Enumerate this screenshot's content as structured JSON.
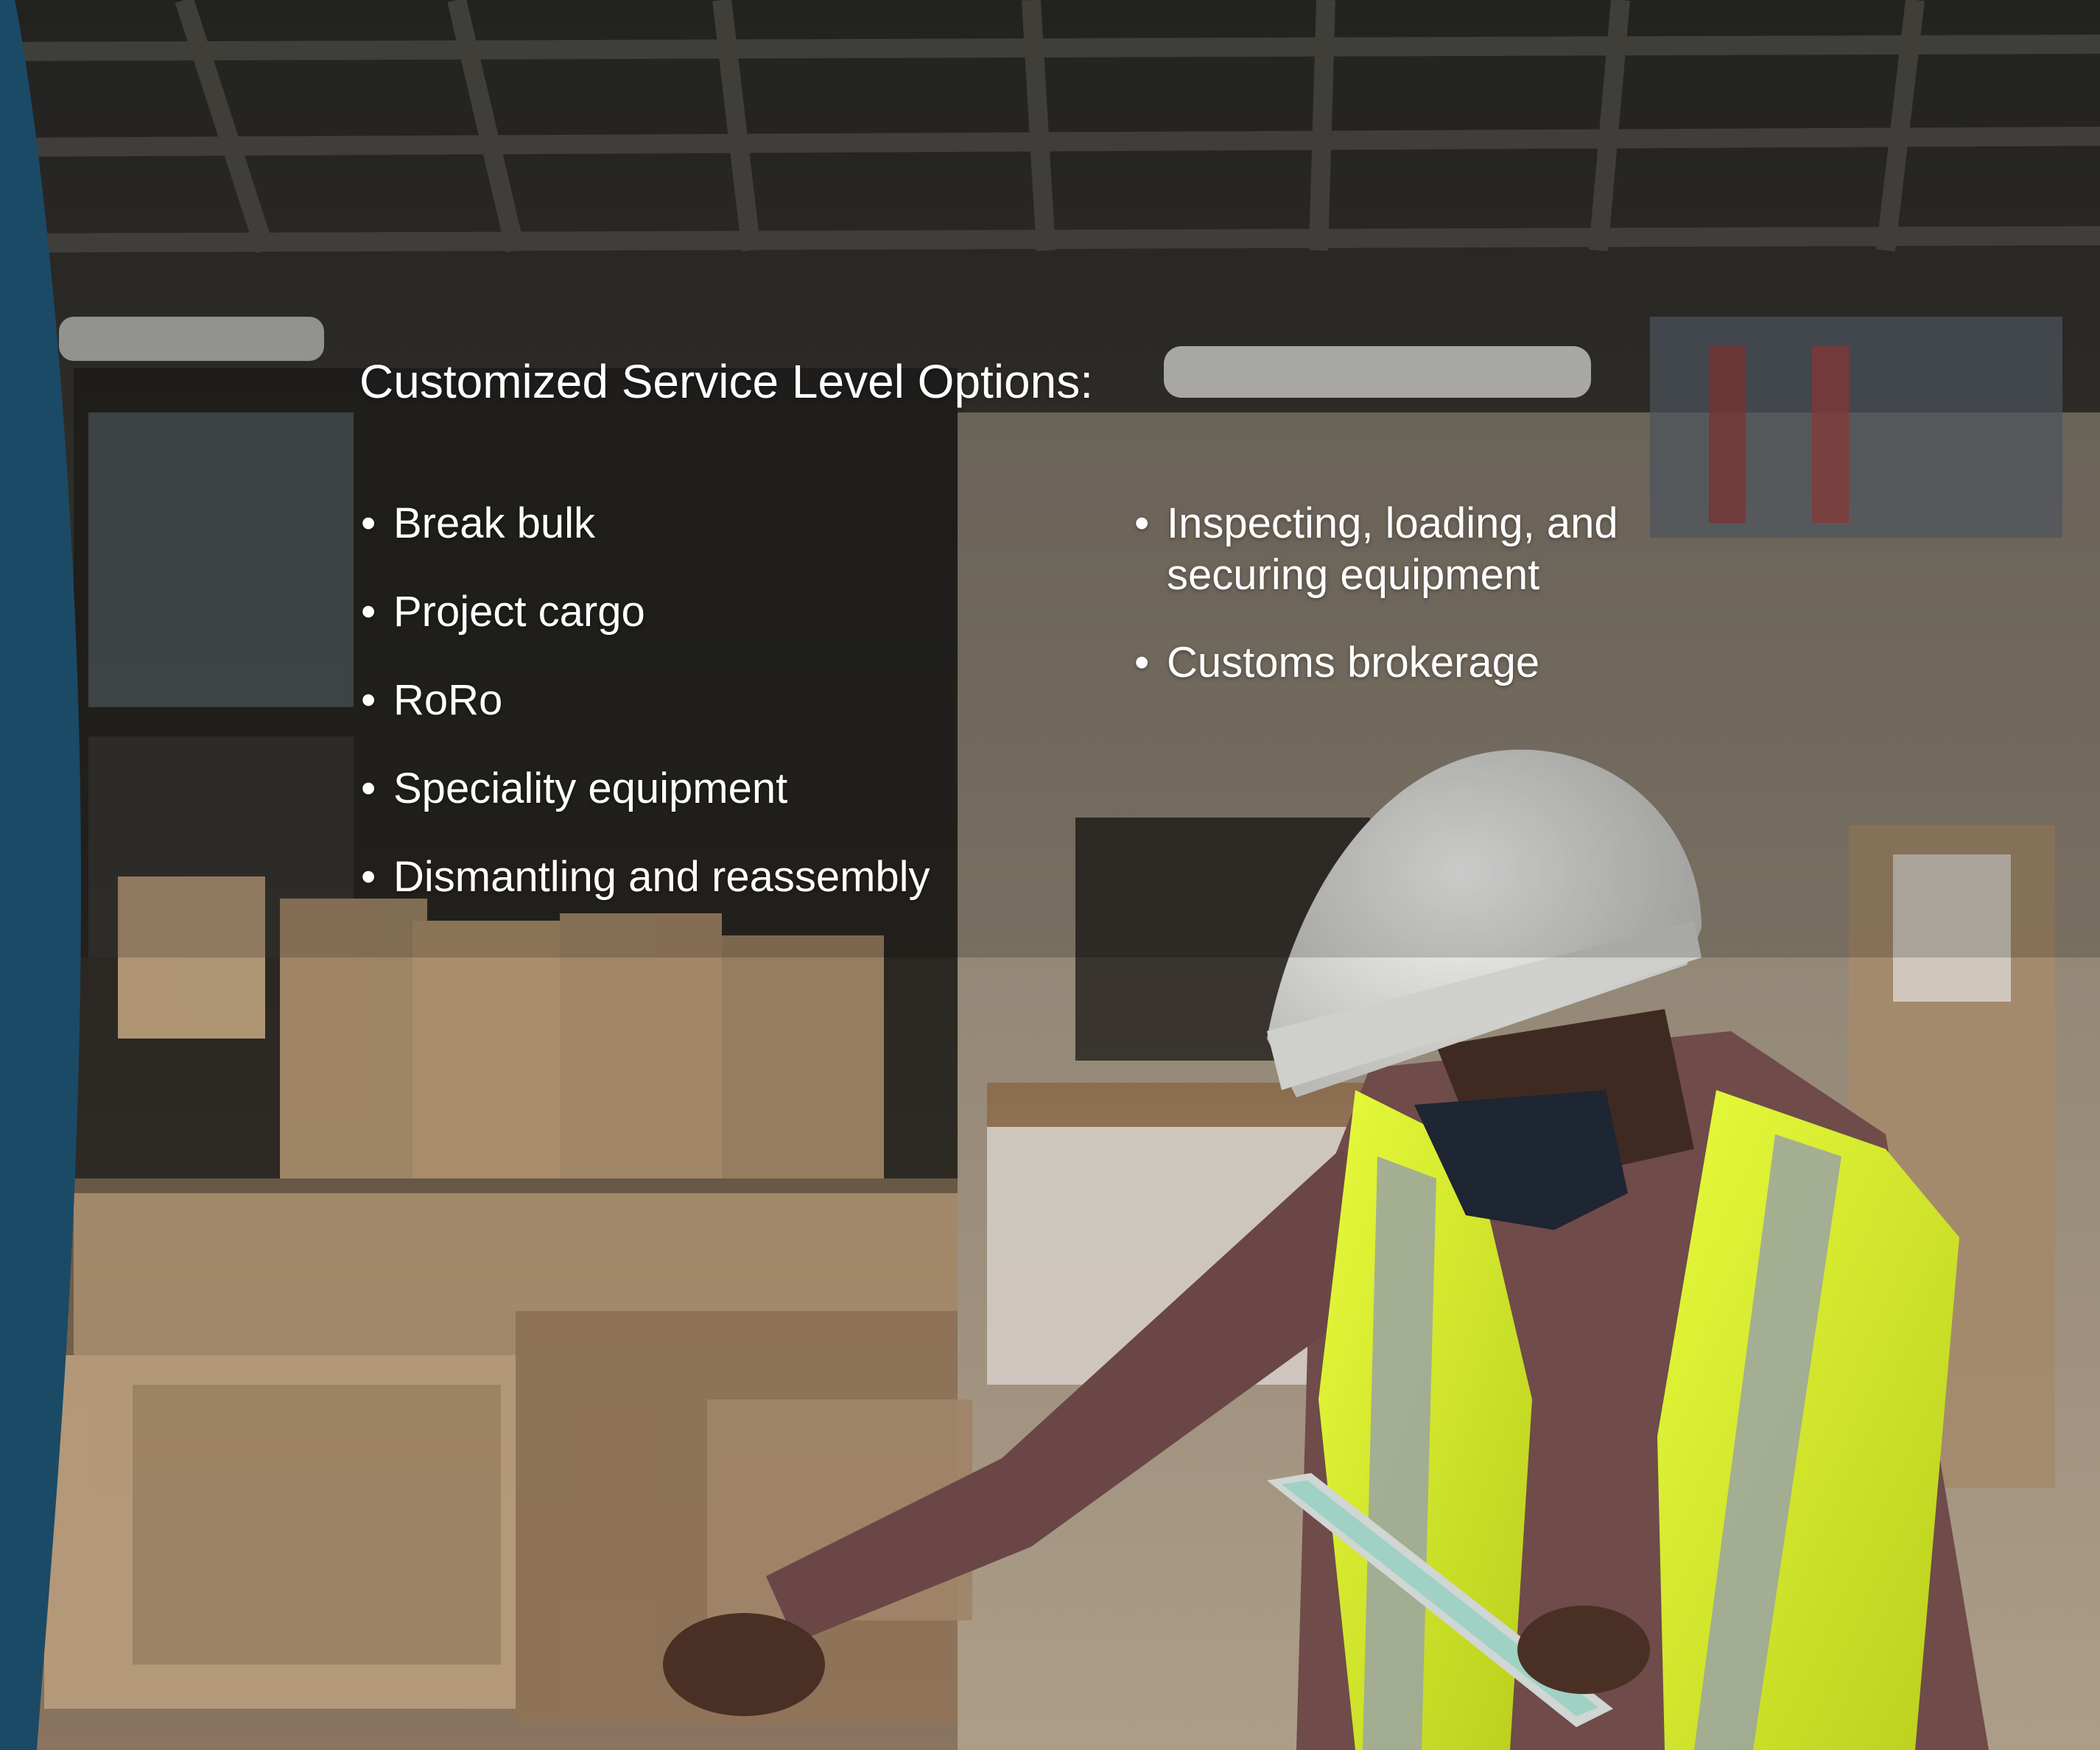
{
  "heading": "Customized Service Level Options:",
  "left_list": [
    "Break bulk",
    "Project cargo",
    "RoRo",
    "Speciality equipment",
    "Dismantling and reassembly"
  ],
  "right_list": [
    "Inspecting, loading, and securing equipment",
    "Customs brokerage"
  ],
  "colors": {
    "accent_band": "#1b4a66",
    "text": "#ffffff",
    "vest": "#d8f02a",
    "helmet": "#e6e6e4"
  }
}
